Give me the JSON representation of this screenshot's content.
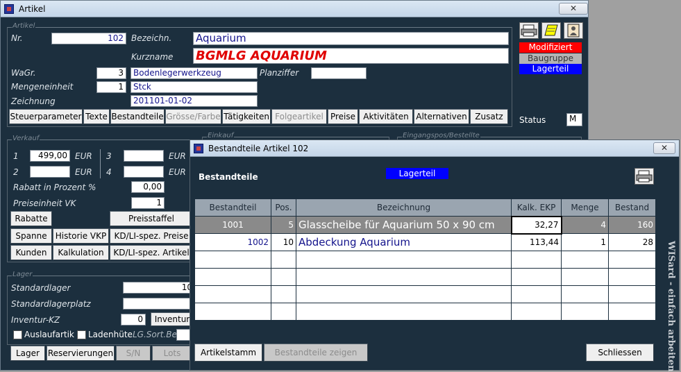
{
  "main_window": {
    "title": "Artikel",
    "close": "✕",
    "artikel_group": {
      "label": "Artikel",
      "nr_label": "Nr.",
      "nr_value": "102",
      "bezeichn_label": "Bezeichn.",
      "bezeichn_value": "Aquarium",
      "kurzname_label": "Kurzname",
      "kurzname_value": "BGMLG AQUARIUM",
      "wagr_label": "WaGr.",
      "wagr_value": "3",
      "wagr_text": "Bodenlegerwerkzeug",
      "planziffer_label": "Planziffer",
      "planziffer_value": "",
      "mengeneinheit_label": "Mengeneinheit",
      "mengeneinheit_value": "1",
      "mengeneinheit_text": "Stck",
      "zeichnung_label": "Zeichnung",
      "zeichnung_value": "201101-01-02"
    },
    "tabs": [
      "Steuerparameter",
      "Texte",
      "Bestandteile",
      "Grösse/Farbe",
      "Tätigkeiten",
      "Folgeartikel",
      "Preise",
      "Aktivitäten",
      "Alternativen",
      "Zusatz"
    ],
    "status_badges": {
      "modifiziert": "Modifiziert",
      "baugruppe": "Baugruppe",
      "lagerteil": "Lagerteil"
    },
    "status_label": "Status",
    "status_value": "M",
    "verkauf_group": {
      "label": "Verkauf",
      "row1_num": "1",
      "row1_value": "499,00",
      "row1_currency": "EUR",
      "row3_num": "3",
      "row3_value": "",
      "row3_currency": "EUR",
      "row2_num": "2",
      "row2_value": "",
      "row2_currency": "EUR",
      "row4_num": "4",
      "row4_value": "",
      "row4_currency": "EUR",
      "rabatt_label": "Rabatt in Prozent %",
      "rabatt_value": "0,00",
      "preiseinheit_label": "Preiseinheit VK",
      "preiseinheit_value": "1",
      "buttons": {
        "rabatte": "Rabatte",
        "preisstaffel": "Preisstaffel",
        "spanne": "Spanne",
        "historie": "Historie VKP",
        "kdli_preise": "KD/LI-spez. Preise",
        "kunden": "Kunden",
        "kalkulation": "Kalkulation",
        "kdli_artikel": "KD/LI-spez. Artikel"
      }
    },
    "einkauf_group": {
      "label": "Einkauf"
    },
    "zugang_group": {
      "label": "Eingangspos/Bestellte"
    },
    "lager_group": {
      "label": "Lager",
      "standardlager_label": "Standardlager",
      "standardlager_value": "10",
      "standardlagerplatz_label": "Standardlagerplatz",
      "standardlagerplatz_value": "",
      "inventur_kz_label": "Inventur-KZ",
      "inventur_kz_value": "0",
      "inventur_button": "Inventur",
      "auslaufartikel_label": "Auslaufartik",
      "ladenhueter_label": "Ladenhüte",
      "lgsort_label": "LG.Sort.Be",
      "buttons": {
        "lager": "Lager",
        "reservierungen": "Reservierungen",
        "sn": "S/N",
        "lots": "Lots"
      }
    }
  },
  "dialog": {
    "title": "Bestandteile Artikel 102",
    "close": "✕",
    "heading": "Bestandteile",
    "badge": "Lagerteil",
    "vertical_text": "WISard - einfach arbeiten",
    "columns": [
      "Bestandteil",
      "Pos.",
      "Bezeichnung",
      "Kalk. EKP",
      "Menge",
      "Bestand"
    ],
    "rows": [
      {
        "bestandteil": "1001",
        "pos": "5",
        "bezeichnung": "Glasscheibe für Aquarium 50 x 90 cm",
        "ekp": "32,27",
        "menge": "4",
        "bestand": "160"
      },
      {
        "bestandteil": "1002",
        "pos": "10",
        "bezeichnung": "Abdeckung Aquarium",
        "ekp": "113,44",
        "menge": "1",
        "bestand": "28"
      },
      {
        "bestandteil": "",
        "pos": "",
        "bezeichnung": "",
        "ekp": "",
        "menge": "",
        "bestand": ""
      },
      {
        "bestandteil": "",
        "pos": "",
        "bezeichnung": "",
        "ekp": "",
        "menge": "",
        "bestand": ""
      },
      {
        "bestandteil": "",
        "pos": "",
        "bezeichnung": "",
        "ekp": "",
        "menge": "",
        "bestand": ""
      },
      {
        "bestandteil": "",
        "pos": "",
        "bezeichnung": "",
        "ekp": "",
        "menge": "",
        "bestand": ""
      }
    ],
    "buttons": {
      "artikelstamm": "Artikelstamm",
      "bestandteile_zeigen": "Bestandteile zeigen",
      "schliessen": "Schliessen"
    }
  },
  "colors": {
    "window_bg": "#1c2f3e",
    "modifiziert": "#ff0000",
    "baugruppe": "#b4b4b4",
    "lagerteil": "#0000ff"
  }
}
